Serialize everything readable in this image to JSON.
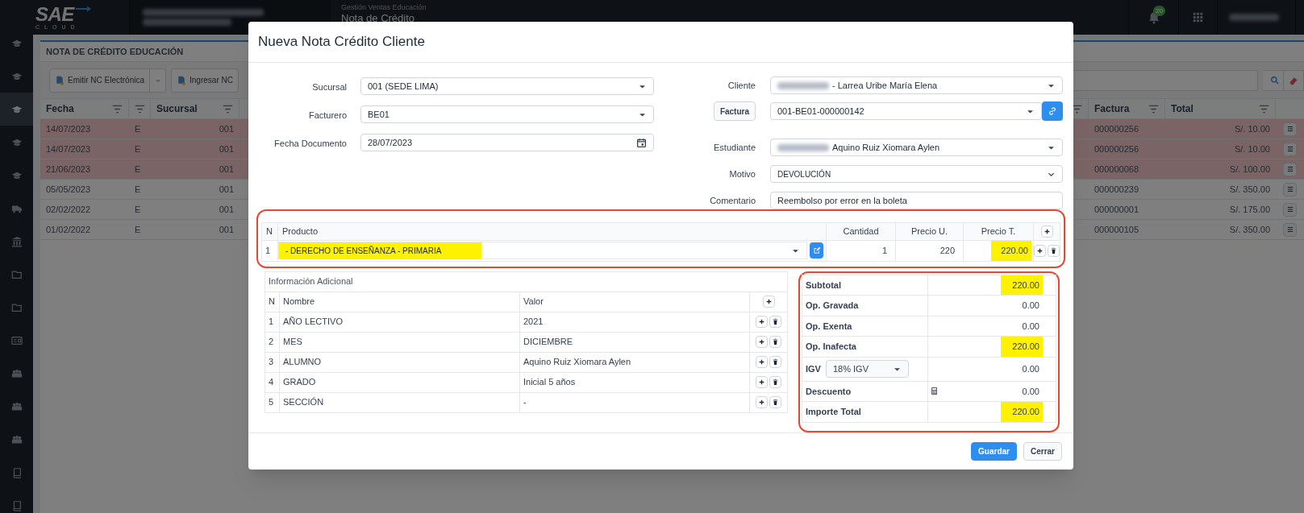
{
  "header": {
    "logo": "SAE",
    "logo_sub": "CLOUD",
    "company": {
      "redacted": true
    },
    "module": "Gestión Ventas Educación",
    "page": "Nota de Crédito",
    "notifications": "20",
    "user": {
      "redacted": true
    }
  },
  "sidebar": {
    "items": [
      {
        "kind": "cap",
        "selected": false
      },
      {
        "kind": "cap",
        "selected": false
      },
      {
        "kind": "cap",
        "selected": true
      },
      {
        "kind": "cap",
        "selected": false
      },
      {
        "kind": "cap",
        "selected": false
      },
      {
        "kind": "truck",
        "selected": false
      },
      {
        "kind": "bank",
        "selected": false
      },
      {
        "kind": "folder",
        "selected": false
      },
      {
        "kind": "folder",
        "selected": false
      },
      {
        "kind": "card",
        "selected": false
      },
      {
        "kind": "group",
        "selected": false
      },
      {
        "kind": "group",
        "selected": false
      },
      {
        "kind": "group",
        "selected": false
      },
      {
        "kind": "book",
        "selected": false
      },
      {
        "kind": "book",
        "selected": false
      }
    ]
  },
  "page": {
    "title": "NOTA DE CRÉDITO EDUCACIÓN",
    "toolbar": [
      {
        "label": "Emitir NC Electrónica",
        "has_menu": true
      },
      {
        "label": "Ingresar NC",
        "has_menu": false
      }
    ]
  },
  "list": {
    "columns": {
      "fecha": "Fecha",
      "sucursal": "Sucursal",
      "factura": "Factura",
      "total": "Total"
    },
    "rows": [
      {
        "fecha": "14/07/2023",
        "column_2": "E",
        "sucursal": "001",
        "factura": "000000256",
        "total": "S/. 10.00",
        "flagged": true
      },
      {
        "fecha": "14/07/2023",
        "column_2": "E",
        "sucursal": "001",
        "factura": "000000256",
        "total": "S/. 10.00",
        "flagged": true
      },
      {
        "fecha": "21/06/2023",
        "column_2": "E",
        "sucursal": "001",
        "factura": "000000068",
        "total": "S/. 100.00",
        "flagged": true
      },
      {
        "fecha": "05/05/2023",
        "column_2": "E",
        "sucursal": "001",
        "factura": "000000239",
        "total": "S/. 350.00",
        "flagged": false
      },
      {
        "fecha": "02/02/2022",
        "column_2": "E",
        "sucursal": "001",
        "factura": "000000001",
        "total": "S/. 175.00",
        "flagged": false
      },
      {
        "fecha": "01/02/2022",
        "column_2": "E",
        "sucursal": "001",
        "factura": "000000105",
        "total": "S/. 350.00",
        "flagged": false
      }
    ]
  },
  "dialog": {
    "title": "Nueva Nota Crédito Cliente",
    "left_fields": [
      {
        "label": "Sucursal",
        "value": "001 (SEDE LIMA)",
        "kind": "select"
      },
      {
        "label": "Facturero",
        "value": "BE01",
        "kind": "select"
      },
      {
        "label": "Fecha Documento",
        "value": "28/07/2023",
        "kind": "date"
      }
    ],
    "right_fields": [
      {
        "label": "Cliente",
        "value": "- Larrea Uribe María Elena",
        "kind": "select",
        "redacted": true
      },
      {
        "label": "Factura",
        "value": "001-BE01-000000142",
        "kind": "linked_select",
        "redacted": false
      },
      {
        "label": "Estudiante",
        "value": "Aquino Ruiz Xiomara Aylen",
        "kind": "select",
        "redacted": true
      },
      {
        "label": "Motivo",
        "value": "DEVOLUCIÓN",
        "kind": "chevron_select",
        "redacted": false
      },
      {
        "label": "Comentario",
        "value": "Reembolso por error en la boleta",
        "kind": "text",
        "redacted": false
      }
    ],
    "products": {
      "outlined": true,
      "columns": [
        "N",
        "Producto",
        "Cantidad",
        "Precio U.",
        "Precio T."
      ],
      "rows": [
        {
          "n": "1",
          "product": "- DERECHO DE ENSEÑANZA - PRIMARIA",
          "product_highlighted": true,
          "quantity": "1",
          "unit_price": "220",
          "total": "220.00",
          "total_highlighted": true
        }
      ]
    },
    "additional": {
      "title": "Información Adicional",
      "columns": [
        "N",
        "Nombre",
        "Valor"
      ],
      "rows": [
        {
          "n": "1",
          "name": "AÑO LECTIVO",
          "value": "2021"
        },
        {
          "n": "2",
          "name": "MES",
          "value": "DICIEMBRE"
        },
        {
          "n": "3",
          "name": "ALUMNO",
          "value": "Aquino Ruiz Xiomara Aylen"
        },
        {
          "n": "4",
          "name": "GRADO",
          "value": "Inicial 5 años"
        },
        {
          "n": "5",
          "name": "SECCIÓN",
          "value": "-"
        }
      ]
    },
    "totals": {
      "outlined": true,
      "rows": [
        {
          "label": "Subtotal",
          "value": "220.00",
          "kind": "plain",
          "highlighted": true
        },
        {
          "label": "Op. Gravada",
          "value": "0.00",
          "kind": "plain",
          "highlighted": false
        },
        {
          "label": "Op. Exenta",
          "value": "0.00",
          "kind": "plain",
          "highlighted": false
        },
        {
          "label": "Op. Inafecta",
          "value": "220.00",
          "kind": "plain",
          "highlighted": true
        },
        {
          "label": "IGV",
          "option": "18% IGV",
          "value": "0.00",
          "kind": "select",
          "highlighted": false
        },
        {
          "label": "Descuento",
          "value": "0.00",
          "kind": "calculator",
          "highlighted": false
        },
        {
          "label": "Importe Total",
          "value": "220.00",
          "kind": "plain",
          "highlighted": true
        }
      ]
    },
    "buttons": [
      {
        "label": "Guardar",
        "kind": "primary"
      },
      {
        "label": "Cerrar",
        "kind": "secondary"
      }
    ]
  }
}
